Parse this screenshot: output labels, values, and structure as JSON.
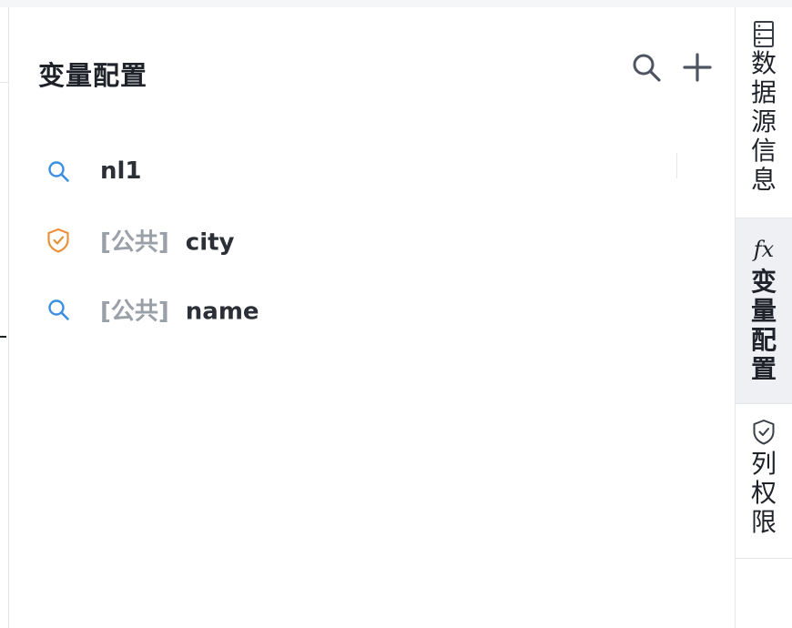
{
  "panel": {
    "title": "变量配置"
  },
  "variables": [
    {
      "icon": "search-icon",
      "tag": "",
      "name": "nl1"
    },
    {
      "icon": "shield-check-icon",
      "tag": "[公共]",
      "name": "city"
    },
    {
      "icon": "search-icon",
      "tag": "[公共]",
      "name": "name"
    }
  ],
  "rail": {
    "tabs": [
      {
        "icon": "datasource-icon",
        "label": "数据源信息",
        "active": false
      },
      {
        "icon": "fx-icon",
        "icon_text": "fx",
        "label": "变量配置",
        "active": true
      },
      {
        "icon": "shield-check-icon",
        "label": "列权限",
        "active": false
      }
    ]
  },
  "colors": {
    "accent_blue": "#3b8fe0",
    "shield_orange": "#e8913a",
    "tag_gray": "#9aa0a8",
    "active_tab_bg": "#eef0f3"
  }
}
